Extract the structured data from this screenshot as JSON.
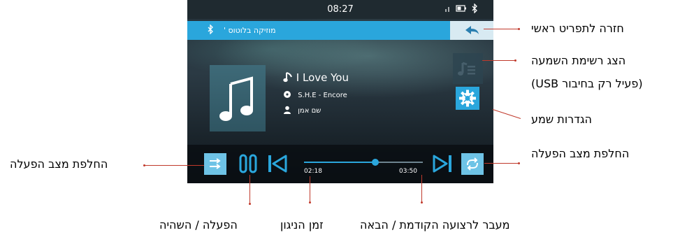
{
  "status_bar": {
    "time": "08:27"
  },
  "title_bar": {
    "source_label": "מוזיקה בלוטוס '"
  },
  "now_playing": {
    "track": "I Love You",
    "album": "S.H.E - Encore",
    "artist": "שם אמן"
  },
  "playback": {
    "elapsed": "02:18",
    "total": "03:50",
    "progress": 0.6
  },
  "callouts": {
    "back_to_main": "חזרה לתפריט ראשי",
    "show_playlist": "הצג רשימת השמעה",
    "show_playlist_note": "(פעיל רק בחיבור USB)",
    "sound_settings": "הגדרות שמע",
    "repeat_mode": "החלפת מצב הפעלה",
    "shuffle_mode": "החלפת מצב הפעלה",
    "play_pause": "הפעלה / השהיה",
    "track_time": "זמן הניגון",
    "prev_next": "מעבר לרצועה הקודמת / הבאה"
  },
  "colors": {
    "accent": "#2aa6dc",
    "callout_line": "#c0392b"
  },
  "icons": [
    "bluetooth-icon",
    "battery-icon",
    "signal-icon",
    "back-arrow-icon",
    "music-note-icon",
    "vinyl-icon",
    "person-icon",
    "playlist-icon",
    "gear-icon",
    "shuffle-icon",
    "pause-icon",
    "previous-icon",
    "next-icon",
    "repeat-icon"
  ]
}
